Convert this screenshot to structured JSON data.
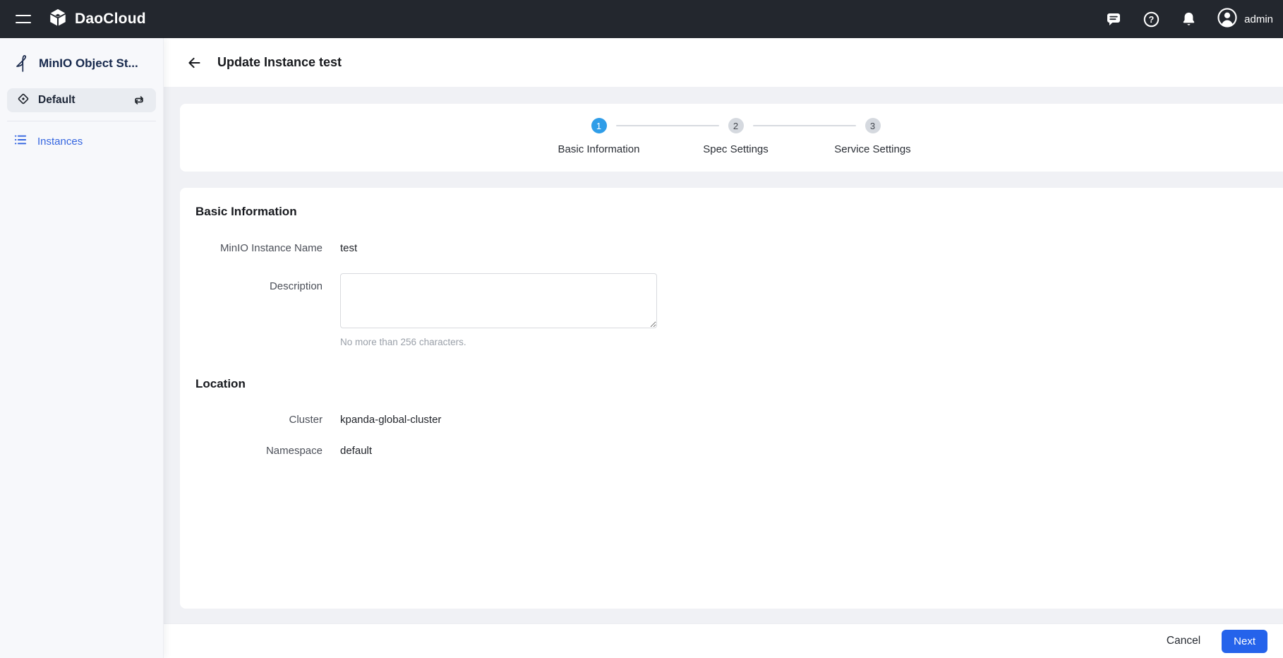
{
  "colors": {
    "topbar_bg": "#23272e",
    "accent": "#2563eb",
    "step_active": "#2f9de8",
    "link": "#3566e0"
  },
  "topbar": {
    "brand": "DaoCloud",
    "user": "admin",
    "icons": {
      "menu": "hamburger",
      "chat": "speech-bubble",
      "help": "question-circle",
      "notifications": "bell",
      "avatar": "person-circle"
    }
  },
  "sidebar": {
    "product_title": "MinIO Object St...",
    "product_icon": "minio-bird",
    "workspace": {
      "label": "Default",
      "icon": "diamond",
      "action_icon": "swap-arrows"
    },
    "items": [
      {
        "label": "Instances",
        "icon": "list",
        "active": true
      }
    ]
  },
  "header": {
    "title": "Update Instance test",
    "back_icon": "arrow-left"
  },
  "stepper": {
    "steps": [
      {
        "num": "1",
        "label": "Basic Information",
        "active": true
      },
      {
        "num": "2",
        "label": "Spec Settings",
        "active": false
      },
      {
        "num": "3",
        "label": "Service Settings",
        "active": false
      }
    ]
  },
  "form": {
    "basic_section_title": "Basic Information",
    "name": {
      "label": "MinIO Instance Name",
      "value": "test"
    },
    "description": {
      "label": "Description",
      "value": "",
      "helper": "No more than 256 characters."
    },
    "location_section_title": "Location",
    "cluster": {
      "label": "Cluster",
      "value": "kpanda-global-cluster"
    },
    "namespace": {
      "label": "Namespace",
      "value": "default"
    }
  },
  "footer": {
    "cancel_label": "Cancel",
    "next_label": "Next"
  }
}
